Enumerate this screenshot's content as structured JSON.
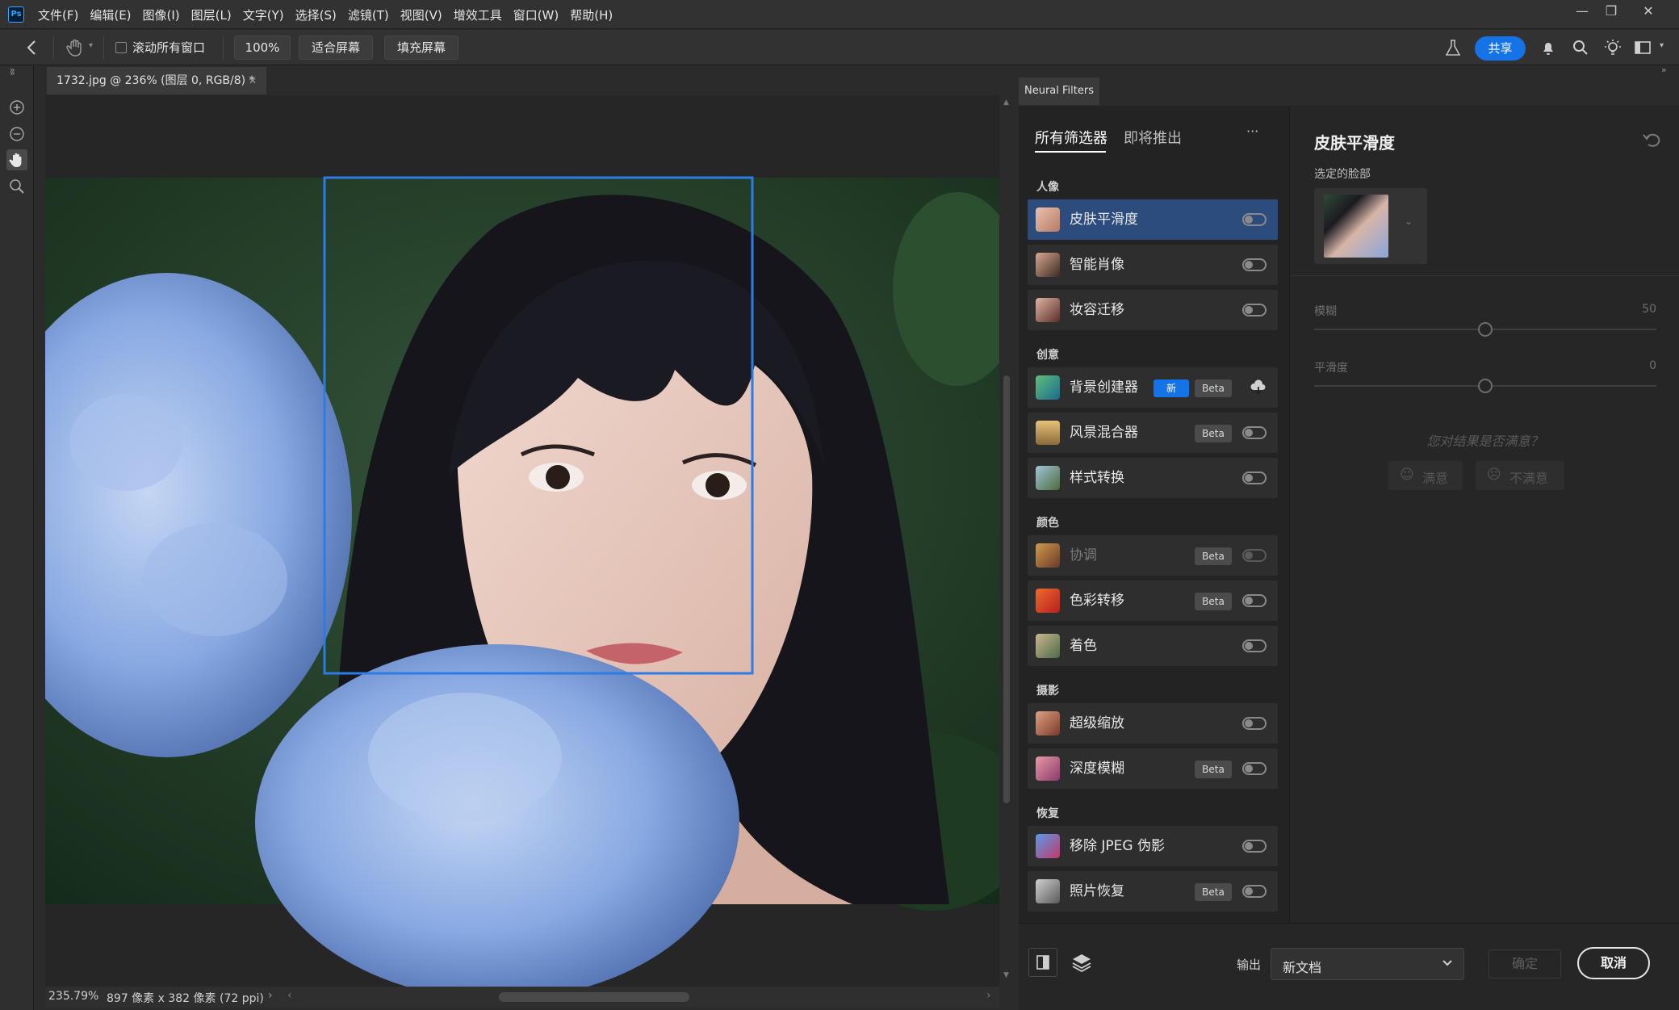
{
  "app": {
    "logo": "Ps"
  },
  "menu": [
    "文件(F)",
    "编辑(E)",
    "图像(I)",
    "图层(L)",
    "文字(Y)",
    "选择(S)",
    "滤镜(T)",
    "视图(V)",
    "增效工具",
    "窗口(W)",
    "帮助(H)"
  ],
  "options": {
    "scroll_all": "滚动所有窗口",
    "zoom": "100%",
    "fit_screen": "适合屏幕",
    "fill_screen": "填充屏幕",
    "share": "共享"
  },
  "document": {
    "tab_title": "1732.jpg @ 236% (图层 0, RGB/8) *"
  },
  "status": {
    "zoom": "235.79%",
    "info": "897 像素 x 382 像素 (72 ppi)"
  },
  "neural_filters": {
    "panel_title": "Neural Filters",
    "tabs": [
      "所有筛选器",
      "即将推出"
    ],
    "more": "···",
    "categories": [
      {
        "name": "人像",
        "filters": [
          {
            "name": "皮肤平滑度"
          },
          {
            "name": "智能肖像"
          },
          {
            "name": "妆容迁移"
          }
        ]
      },
      {
        "name": "创意",
        "filters": [
          {
            "name": "背景创建器",
            "new": "新",
            "beta": "Beta"
          },
          {
            "name": "风景混合器",
            "beta": "Beta"
          },
          {
            "name": "样式转换"
          }
        ]
      },
      {
        "name": "颜色",
        "filters": [
          {
            "name": "协调",
            "beta": "Beta"
          },
          {
            "name": "色彩转移",
            "beta": "Beta"
          },
          {
            "name": "着色"
          }
        ]
      },
      {
        "name": "摄影",
        "filters": [
          {
            "name": "超级缩放"
          },
          {
            "name": "深度模糊",
            "beta": "Beta"
          }
        ]
      },
      {
        "name": "恢复",
        "filters": [
          {
            "name": "移除 JPEG 伪影"
          },
          {
            "name": "照片恢复",
            "beta": "Beta"
          }
        ]
      }
    ],
    "detail": {
      "title": "皮肤平滑度",
      "selected_face": "选定的脸部",
      "blur_label": "模糊",
      "blur_value": "50",
      "smooth_label": "平滑度",
      "smooth_value": "0",
      "feedback_question": "您对结果是否满意？",
      "satisfied": "满意",
      "unsatisfied": "不满意"
    },
    "footer": {
      "output_label": "输出",
      "output_value": "新文档",
      "ok": "确定",
      "cancel": "取消"
    }
  },
  "colors": {
    "accent": "#1473e6",
    "selection": "#2d4c7e",
    "face_box": "#2d7be5"
  }
}
